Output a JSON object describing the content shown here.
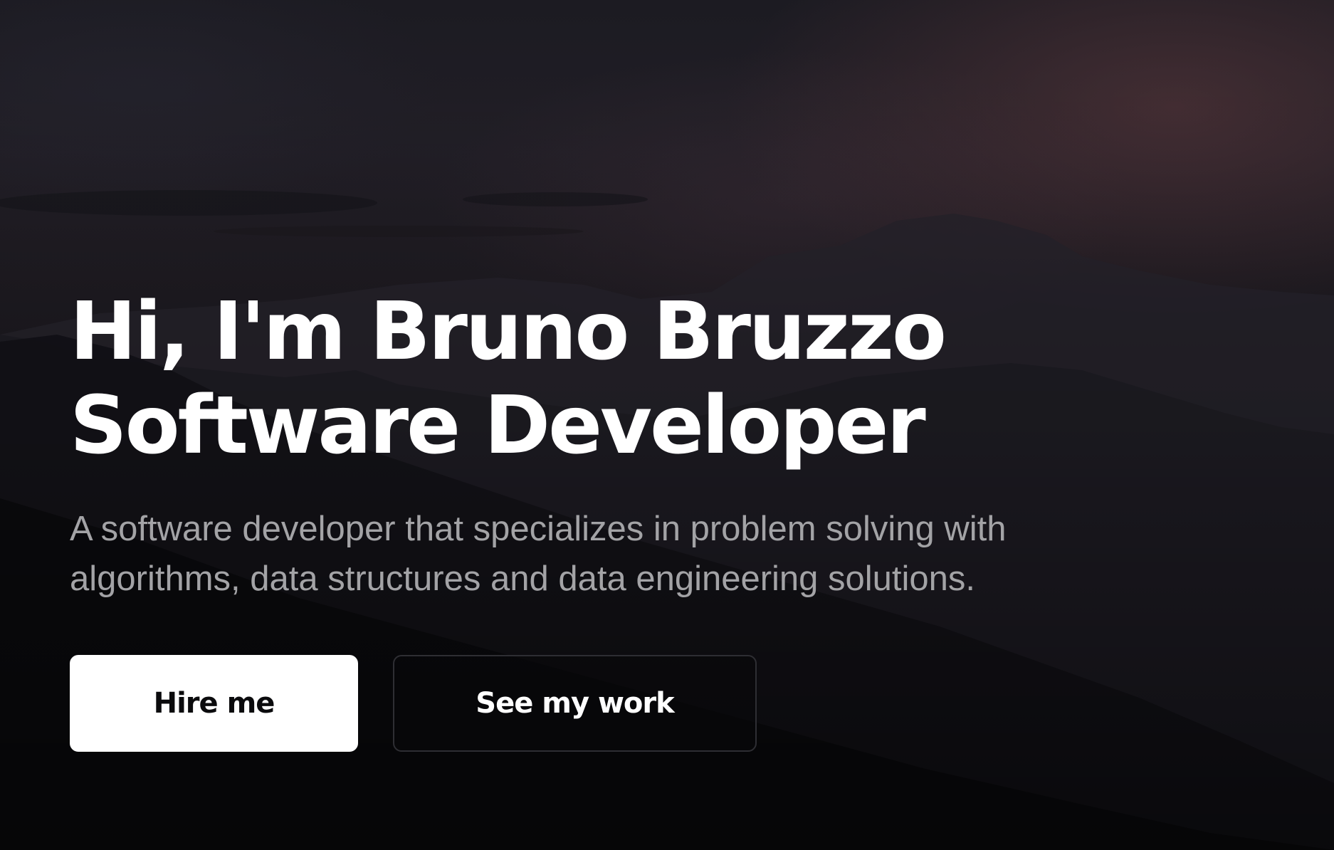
{
  "hero": {
    "headline_line1": "Hi, I'm Bruno Bruzzo",
    "headline_line2": "Software Developer",
    "subtitle": "A software developer that specializes in problem solving with algorithms, data structures and data engineering solutions.",
    "background": "mountain-landscape-at-dusk"
  },
  "actions": {
    "primary_label": "Hire me",
    "secondary_label": "See my work"
  },
  "colors": {
    "headline": "#ffffff",
    "subtitle": "#a3a3a6",
    "primary_button_bg": "#ffffff",
    "primary_button_text": "#0b0b0d",
    "secondary_button_border": "#2e2e33"
  }
}
